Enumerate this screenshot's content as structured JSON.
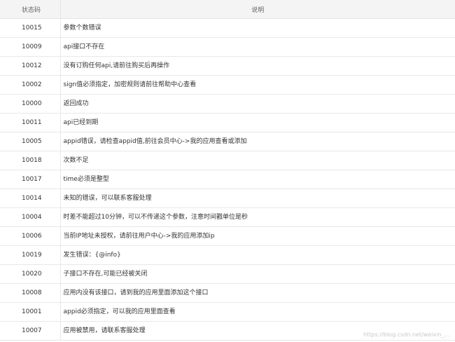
{
  "table": {
    "headers": {
      "code": "状态码",
      "description": "说明"
    },
    "rows": [
      {
        "code": "10015",
        "description": "参数个数错误"
      },
      {
        "code": "10009",
        "description": "api接口不存在"
      },
      {
        "code": "10012",
        "description": "没有订购任何api,请前往购买后再操作"
      },
      {
        "code": "10002",
        "description": "sign值必须指定，加密规则请前往帮助中心查看"
      },
      {
        "code": "10000",
        "description": "返回成功"
      },
      {
        "code": "10011",
        "description": "api已经到期"
      },
      {
        "code": "10005",
        "description": "appid错误，请检查appid值,前往会员中心->我的应用查看或添加"
      },
      {
        "code": "10018",
        "description": "次数不足"
      },
      {
        "code": "10017",
        "description": "time必须是整型"
      },
      {
        "code": "10014",
        "description": "未知的错误，可以联系客服处理"
      },
      {
        "code": "10004",
        "description": "时差不能超过10分钟，可以不传递这个参数，注意时间戳单位是秒"
      },
      {
        "code": "10006",
        "description": "当前IP地址未授权，请前往用户中心->我的应用添加ip"
      },
      {
        "code": "10019",
        "description": "发生错误：{@info}"
      },
      {
        "code": "10020",
        "description": "子接口不存在,可能已经被关闭"
      },
      {
        "code": "10008",
        "description": "应用内没有该接口，请到我的应用里面添加这个接口"
      },
      {
        "code": "10001",
        "description": "appid必须指定，可以我的应用里面查看"
      },
      {
        "code": "10007",
        "description": "应用被禁用，请联系客服处理"
      }
    ]
  },
  "watermark": "https://blog.csdn.net/weixin_..."
}
